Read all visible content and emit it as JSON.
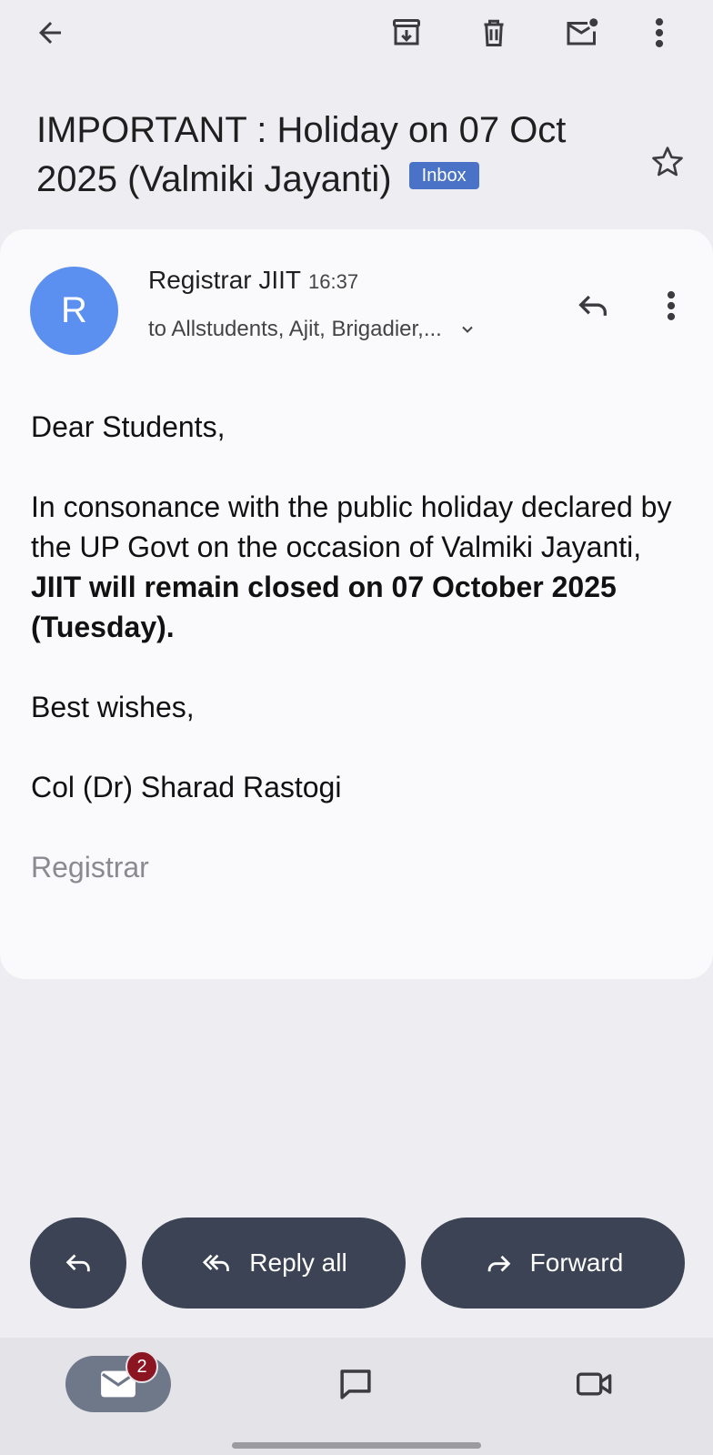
{
  "subject": {
    "title": "IMPORTANT : Holiday on 07 Oct 2025 (Valmiki Jayanti)",
    "label_badge": "Inbox"
  },
  "message": {
    "avatar_letter": "R",
    "sender": "Registrar JIIT",
    "time": "16:37",
    "recipients": "to Allstudents, Ajit, Brigadier,...",
    "greeting": "Dear Students,",
    "para_start": "In consonance with the public holiday declared  by the UP Govt on the occasion of Valmiki Jayanti, ",
    "para_bold": "JIIT will remain closed on 07 October 2025 (Tuesday).",
    "closing": "Best wishes,",
    "signature_name": "Col (Dr) Sharad Rastogi",
    "signature_role": "Registrar"
  },
  "actions": {
    "reply_all_label": "Reply all",
    "forward_label": "Forward"
  },
  "navbar": {
    "mail_unread": "2"
  },
  "icons": {
    "back": "arrow-left-icon",
    "archive": "archive-icon",
    "delete": "trash-icon",
    "mark_unread": "mail-unread-icon",
    "more": "more-vert-icon",
    "star": "star-icon",
    "reply": "reply-icon",
    "reply_all": "reply-all-icon",
    "forward": "forward-icon",
    "mail": "mail-icon",
    "chat": "chat-icon",
    "meet": "video-icon"
  },
  "colors": {
    "background": "#ededf2",
    "card": "#fafafd",
    "avatar": "#5b8ff0",
    "badge": "#4a72c6",
    "pill": "#3b4354",
    "notification": "#8b1520"
  }
}
